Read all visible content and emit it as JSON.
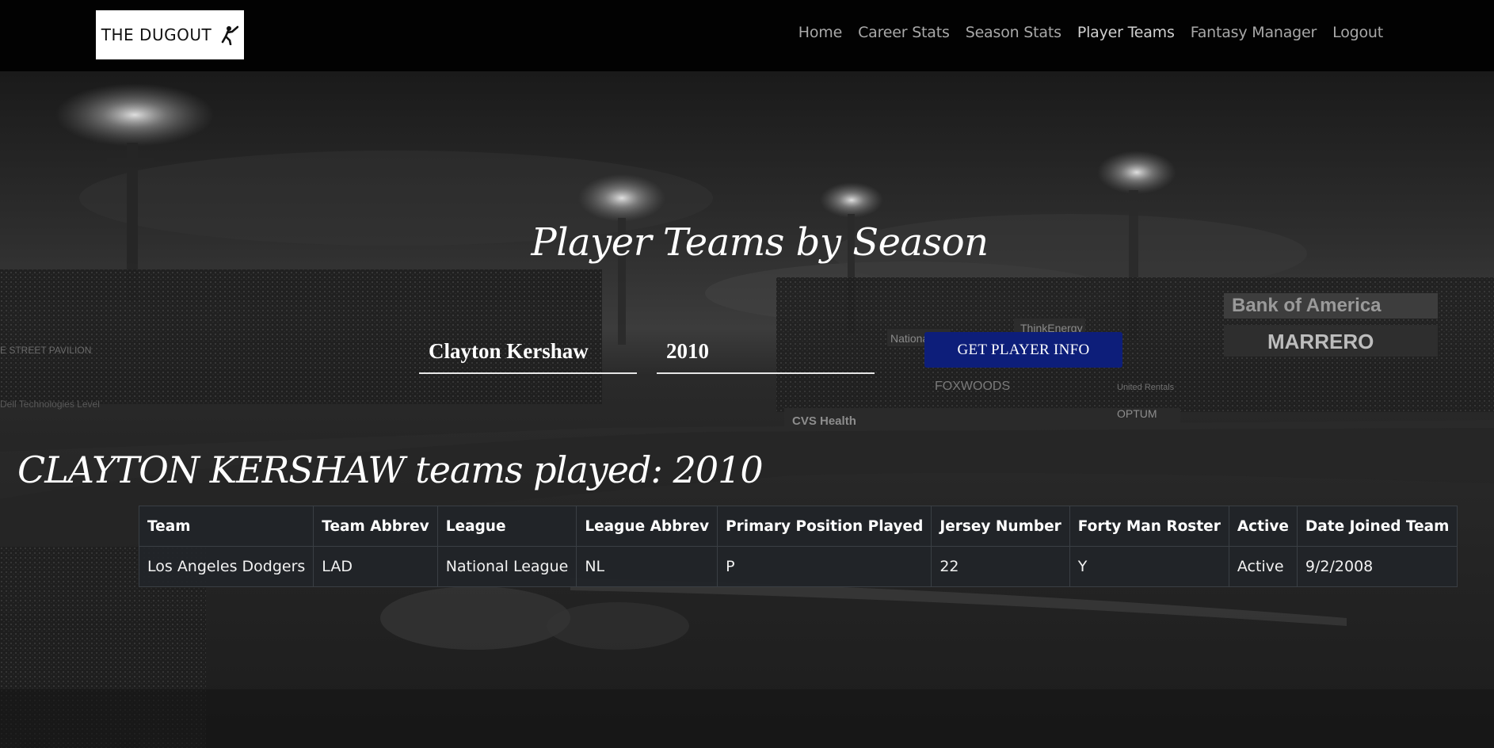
{
  "brand": {
    "name": "THE DUGOUT",
    "icon": "batter-silhouette-icon"
  },
  "nav": {
    "items": [
      {
        "label": "Home"
      },
      {
        "label": "Career Stats"
      },
      {
        "label": "Season Stats"
      },
      {
        "label": "Player Teams"
      },
      {
        "label": "Fantasy Manager"
      },
      {
        "label": "Logout"
      }
    ]
  },
  "page": {
    "title": "Player Teams by Season"
  },
  "search": {
    "player_value": "Clayton Kershaw",
    "season_value": "2010",
    "button_label": "GET PLAYER INFO"
  },
  "result": {
    "player_name": "CLAYTON KERSHAW",
    "suffix": "teams played:",
    "season": "2010"
  },
  "table": {
    "headers": [
      "Team",
      "Team Abbrev",
      "League",
      "League Abbrev",
      "Primary Position Played",
      "Jersey Number",
      "Forty Man Roster",
      "Active",
      "Date Joined Team"
    ],
    "rows": [
      [
        "Los Angeles Dodgers",
        "LAD",
        "National League",
        "NL",
        "P",
        "22",
        "Y",
        "Active",
        "9/2/2008"
      ]
    ]
  },
  "colors": {
    "navbar_bg": "#020202",
    "button_bg": "#0d1e7a",
    "table_bg": "#212529"
  },
  "background": {
    "stadium_signs": [
      "Bank of America",
      "MARRERO",
      "ThinkEnergy",
      "National",
      "FOXWOODS",
      "CVS Health",
      "OPTUM",
      "E STREET PAVILION",
      "Dell Technologies",
      "United Rentals"
    ]
  }
}
